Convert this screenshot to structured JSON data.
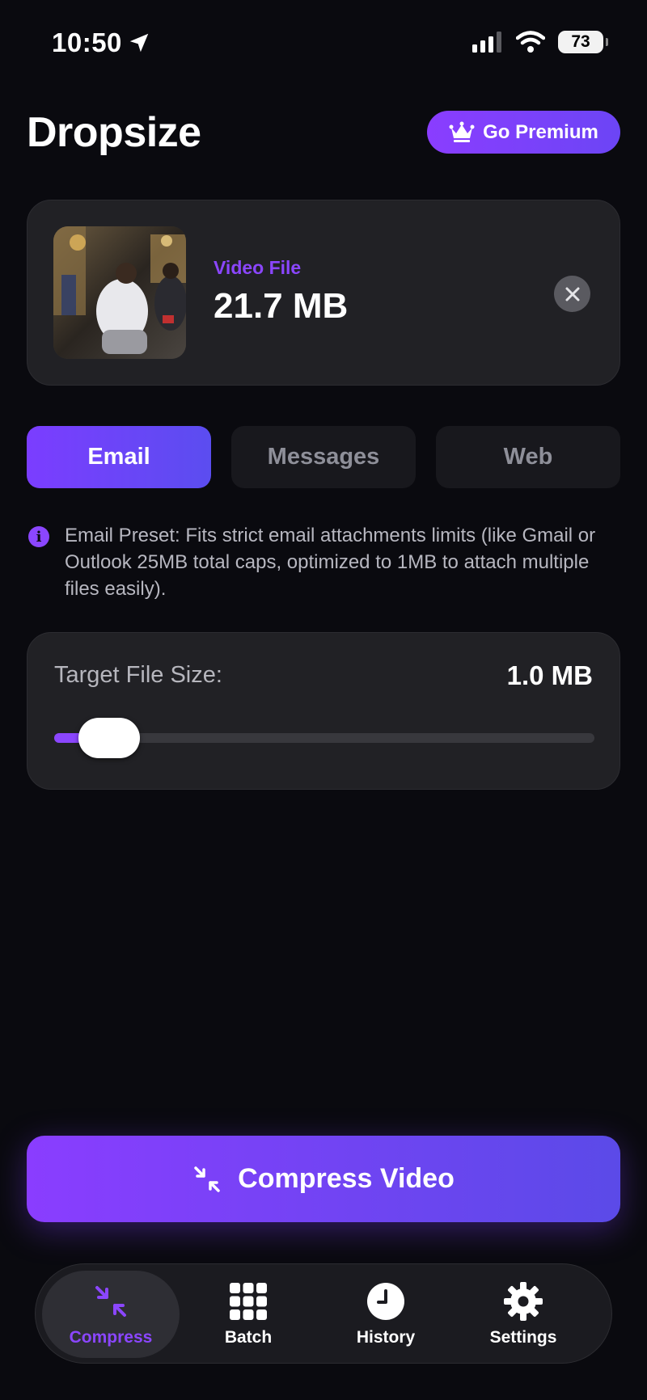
{
  "status_bar": {
    "time": "10:50",
    "battery": "73"
  },
  "header": {
    "title": "Dropsize",
    "premium_label": "Go Premium"
  },
  "file_card": {
    "type_label": "Video File",
    "size": "21.7 MB"
  },
  "presets": {
    "tabs": [
      {
        "label": "Email",
        "active": true
      },
      {
        "label": "Messages",
        "active": false
      },
      {
        "label": "Web",
        "active": false
      }
    ],
    "info": "Email Preset: Fits strict email attachments limits (like Gmail or Outlook 25MB total caps, optimized to 1MB to attach multiple files easily)."
  },
  "target_size": {
    "label": "Target File Size:",
    "value": "1.0 MB",
    "slider_fraction": 0.05
  },
  "compress_button": {
    "label": "Compress Video"
  },
  "nav": {
    "items": [
      {
        "label": "Compress",
        "icon": "compress-icon",
        "active": true
      },
      {
        "label": "Batch",
        "icon": "grid-icon",
        "active": false
      },
      {
        "label": "History",
        "icon": "clock-icon",
        "active": false
      },
      {
        "label": "Settings",
        "icon": "gear-icon",
        "active": false
      }
    ]
  },
  "colors": {
    "accent": "#8b46ff",
    "background": "#0a0a0f",
    "card": "#212125"
  }
}
